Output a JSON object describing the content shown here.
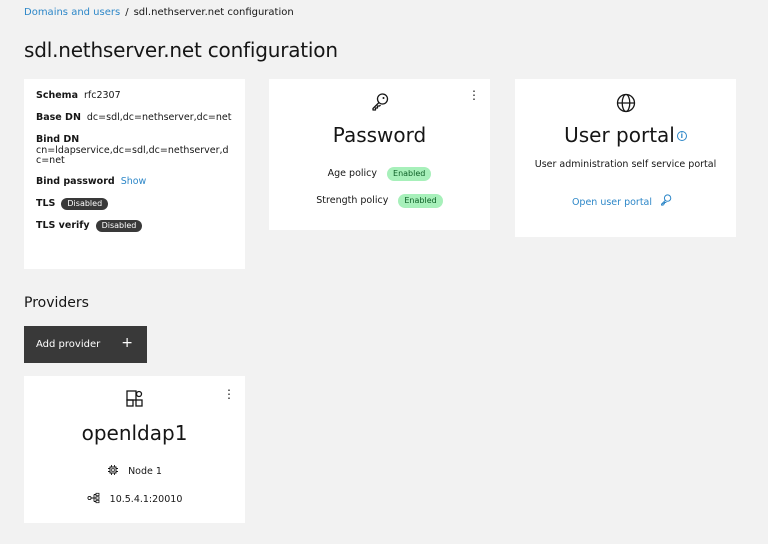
{
  "breadcrumb": {
    "parent": "Domains and users",
    "separator": "/",
    "current": "sdl.nethserver.net configuration"
  },
  "page_title": "sdl.nethserver.net configuration",
  "info": {
    "schema_label": "Schema",
    "schema_value": "rfc2307",
    "base_dn_label": "Base DN",
    "base_dn_value": "dc=sdl,dc=nethserver,dc=net",
    "bind_dn_label": "Bind DN",
    "bind_dn_value": "cn=ldapservice,dc=sdl,dc=nethserver,dc=net",
    "bind_password_label": "Bind password",
    "bind_password_action": "Show",
    "tls_label": "TLS",
    "tls_value": "Disabled",
    "tls_verify_label": "TLS verify",
    "tls_verify_value": "Disabled"
  },
  "password_card": {
    "icon": "key-icon",
    "title": "Password",
    "menu": "⋮",
    "age_policy_label": "Age policy",
    "age_policy_value": "Enabled",
    "strength_policy_label": "Strength policy",
    "strength_policy_value": "Enabled"
  },
  "user_portal_card": {
    "icon": "globe-icon",
    "title": "User portal",
    "info_icon": "i",
    "description": "User administration self service portal",
    "link_label": "Open user portal"
  },
  "providers": {
    "title": "Providers",
    "add_button_label": "Add provider",
    "add_button_icon": "+",
    "items": [
      {
        "name": "openldap1",
        "menu": "⋮",
        "node": "Node 1",
        "address": "10.5.4.1:20010"
      }
    ]
  },
  "colors": {
    "link": "#2d87c8",
    "tag_green_bg": "#a7f0ba",
    "tag_green_text": "#0e6027",
    "tag_dark_bg": "#393939",
    "button_bg": "#393939",
    "background": "#f2f2f2"
  }
}
